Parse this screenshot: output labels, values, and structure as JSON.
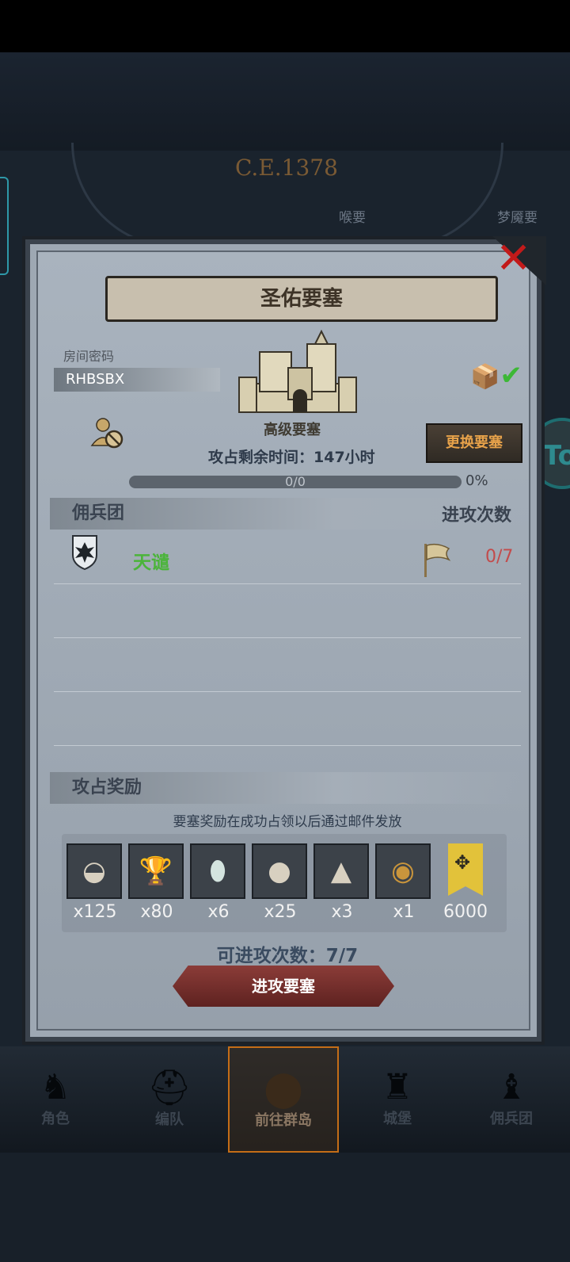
{
  "map": {
    "year": "C.E.1378",
    "labels": [
      "喉要",
      "梦魇要"
    ]
  },
  "side_button": {
    "label": "To"
  },
  "dialog": {
    "title": "圣佑要塞",
    "close_icon": "close-icon",
    "room_code_label": "房间密码",
    "room_code": "RHBSBX",
    "fortress_level": "高级要塞",
    "time_remaining": "攻占剩余时间：147小时",
    "swap_button": "更换要塞",
    "progress": {
      "text": "0/0",
      "percent": "0%"
    },
    "mercenary_header": "佣兵团",
    "attack_count_header": "进攻次数",
    "mercenaries": [
      {
        "name": "天谴",
        "count": "0/7"
      }
    ],
    "rewards_header": "攻占奖励",
    "rewards_note": "要塞奖励在成功占领以后通过邮件发放",
    "rewards": [
      {
        "icon": "salt-sack-icon",
        "qty": "x125"
      },
      {
        "icon": "goblet-icon",
        "qty": "x80"
      },
      {
        "icon": "gem-stone-icon",
        "qty": "x6"
      },
      {
        "icon": "pearls-icon",
        "qty": "x25"
      },
      {
        "icon": "sand-pile-icon",
        "qty": "x3"
      },
      {
        "icon": "helmet-medal-icon",
        "qty": "x1"
      },
      {
        "icon": "rank-chevron-icon",
        "qty": "6000"
      }
    ],
    "available_attacks": "可进攻次数：7/7",
    "attack_button": "进攻要塞"
  },
  "bottom_nav": [
    {
      "label": "角色",
      "icon": "knight-icon"
    },
    {
      "label": "编队",
      "icon": "helmet-icon"
    },
    {
      "label": "前往群岛",
      "icon": "island-icon"
    },
    {
      "label": "城堡",
      "icon": "castle-icon"
    },
    {
      "label": "佣兵团",
      "icon": "mercenary-icon"
    }
  ]
}
